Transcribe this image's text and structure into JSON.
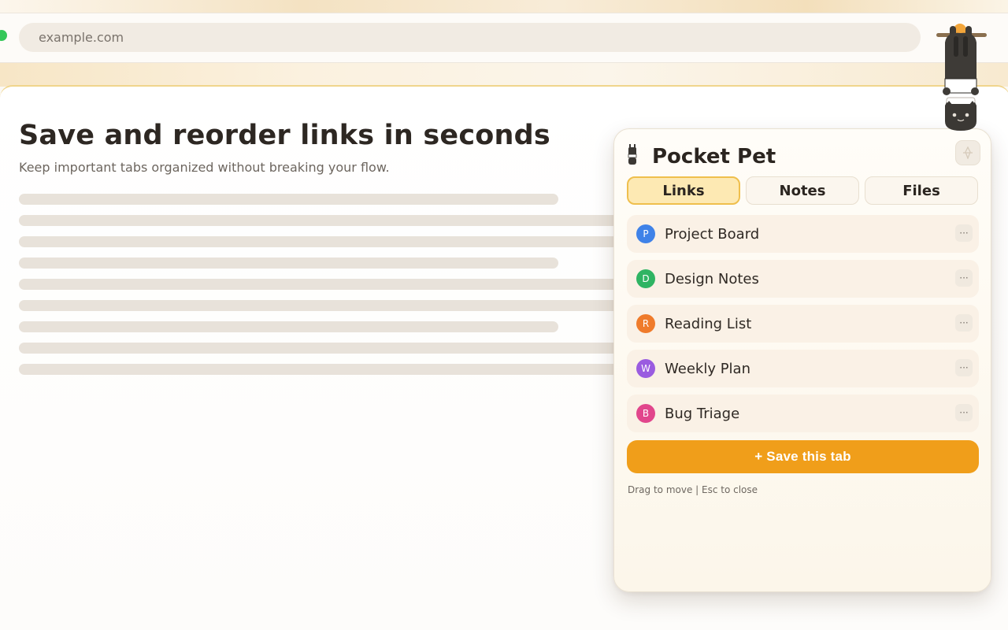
{
  "browser": {
    "address": "example.com"
  },
  "page": {
    "title": "Save and reorder links in seconds",
    "subtitle": "Keep important tabs organized without breaking your flow."
  },
  "panel": {
    "title": "Pocket Pet",
    "tabs": [
      {
        "label": "Links",
        "active": true
      },
      {
        "label": "Notes",
        "active": false
      },
      {
        "label": "Files",
        "active": false
      }
    ],
    "links": [
      {
        "initial": "P",
        "label": "Project Board",
        "color": "#3f82e8"
      },
      {
        "initial": "D",
        "label": "Design Notes",
        "color": "#2fb463"
      },
      {
        "initial": "R",
        "label": "Reading List",
        "color": "#ef7b2b"
      },
      {
        "initial": "W",
        "label": "Weekly Plan",
        "color": "#9a5ce0"
      },
      {
        "initial": "B",
        "label": "Bug Triage",
        "color": "#e1468c"
      }
    ],
    "more_label": "···",
    "save_label": "+ Save this tab",
    "hint": "Drag to move | Esc to close"
  },
  "colors": {
    "accent": "#f09e1a",
    "active_tab": "#fde9b3",
    "status_green": "#35c759"
  },
  "icons": {
    "pin": "pin-icon",
    "more": "more-dots-icon",
    "pet": "hanging-cat-icon",
    "logo": "pet-logo-icon"
  }
}
